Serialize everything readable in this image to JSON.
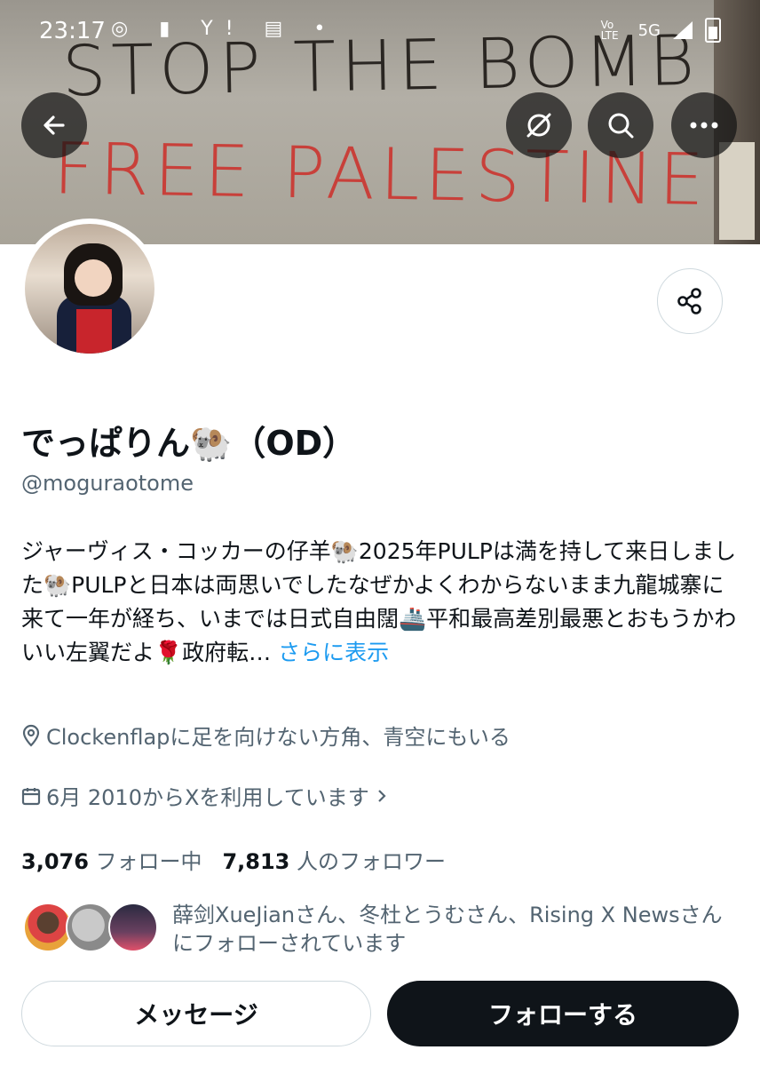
{
  "statusbar": {
    "time": "23:17",
    "left_icons": "◎ ▮ Y! ▤ •",
    "network": "5G",
    "volte": "Vo LTE"
  },
  "banner": {
    "line1": "STOP THE BOMB",
    "line2": "FREE PALESTINE!"
  },
  "profile": {
    "name": "でっぱりん🐏（OD）",
    "handle": "@moguraotome",
    "bio": "ジャーヴィス・コッカーの仔羊🐏2025年PULPは満を持して来日しました🐏PULPと日本は両思いでしたなぜかよくわからないまま九龍城寨に来て一年が経ち、いまでは日式自由闊🚢平和最高差別最悪とおもうかわいい左翼だよ🌹政府転…",
    "bio_more": "さらに表示",
    "location": "Clockenflapに足を向けない方角、青空にもいる",
    "joined": "6月 2010からXを利用しています",
    "following_count": "3,076",
    "following_label": "フォロー中",
    "followers_count": "7,813",
    "followers_label": "人のフォロワー",
    "followed_by": "薛剑XueJianさん、冬杜とうむさん、Rising X Newsさんにフォローされています"
  },
  "buttons": {
    "message": "メッセージ",
    "follow": "フォローする"
  },
  "colors": {
    "link": "#1d9bf0",
    "follow_bg": "#0f1419",
    "muted": "#536471"
  }
}
